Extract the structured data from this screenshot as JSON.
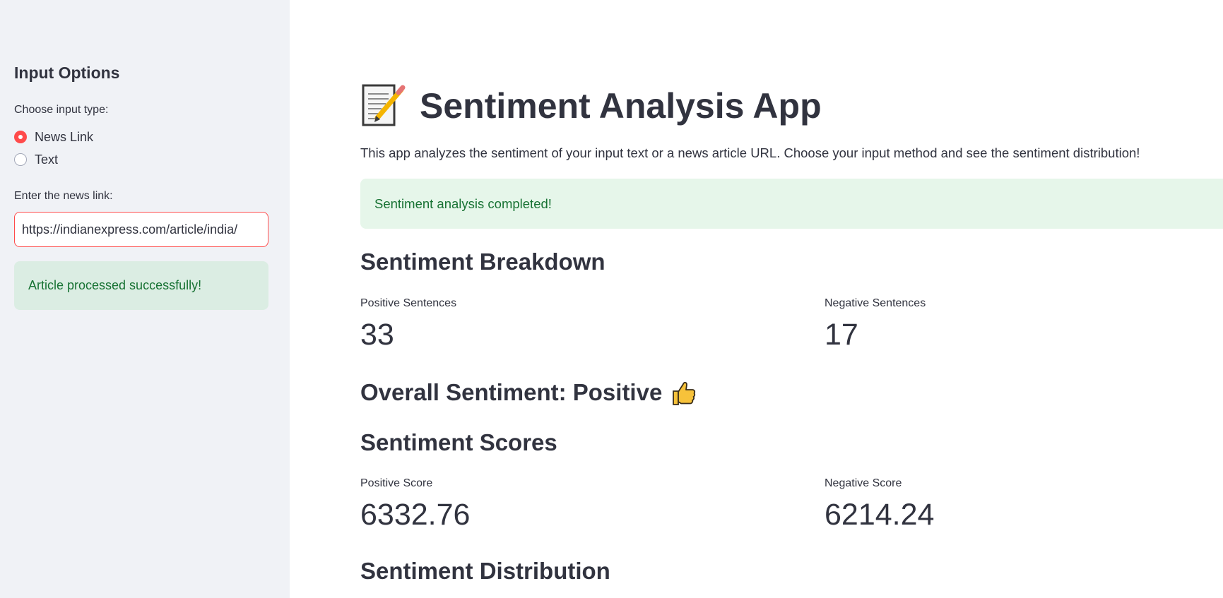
{
  "sidebar": {
    "heading": "Input Options",
    "input_type_label": "Choose input type:",
    "options": [
      {
        "label": "News Link",
        "selected": true
      },
      {
        "label": "Text",
        "selected": false
      }
    ],
    "link_label": "Enter the news link:",
    "link_value": "https://indianexpress.com/article/india/",
    "success_message": "Article processed successfully!"
  },
  "main": {
    "title": "Sentiment Analysis App",
    "title_icon": "memo-icon",
    "description": "This app analyzes the sentiment of your input text or a news article URL. Choose your input method and see the sentiment distribution!",
    "success_message": "Sentiment analysis completed!",
    "breakdown": {
      "heading": "Sentiment Breakdown",
      "positive_label": "Positive Sentences",
      "positive_value": "33",
      "negative_label": "Negative Sentences",
      "negative_value": "17"
    },
    "overall": {
      "heading": "Overall Sentiment: Positive",
      "icon": "thumbs-up-icon"
    },
    "scores": {
      "heading": "Sentiment Scores",
      "positive_label": "Positive Score",
      "positive_value": "6332.76",
      "negative_label": "Negative Score",
      "negative_value": "6214.24"
    },
    "distribution": {
      "heading": "Sentiment Distribution"
    }
  },
  "colors": {
    "accent": "#ff4b4b",
    "sidebar_bg": "#f0f2f6",
    "success_bg": "#dbede3",
    "success_text": "#177233",
    "text": "#31333f"
  }
}
